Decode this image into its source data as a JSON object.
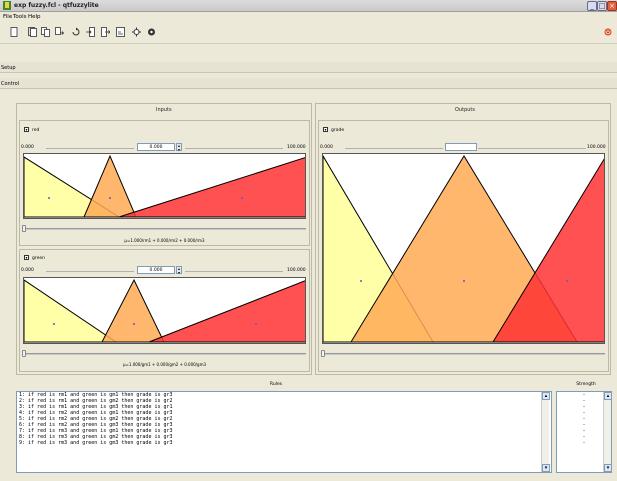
{
  "window": {
    "title": "exp fuzzy.fcl - qtfuzzylite"
  },
  "menu": [
    "File",
    "Tools",
    "Help"
  ],
  "toolbar": {
    "icons": [
      "new-icon",
      "open-icon",
      "copy-icon",
      "paste-icon",
      "undo-icon",
      "import-icon",
      "export-icon",
      "preview-icon",
      "settings-icon",
      "about-icon"
    ],
    "power_icon": "power-icon"
  },
  "sections": {
    "setup": "Setup",
    "control": "Control"
  },
  "inputs": {
    "title": "Inputs",
    "variables": [
      {
        "name": "red",
        "value": "0.000",
        "min": "0.000",
        "max": "100.000",
        "mu": "µ=1.000/rm1 + 0.000/rm2 + 0.000/rm3",
        "slider": 0.0
      },
      {
        "name": "green",
        "value": "0.000",
        "min": "0.000",
        "max": "100.000",
        "mu": "µ=1.000/gm1 + 0.000/gm2 + 0.000/gm3",
        "slider": 0.0
      }
    ]
  },
  "outputs": {
    "title": "Outputs",
    "variables": [
      {
        "name": "grade",
        "value": "",
        "min": "0.000",
        "max": "100.000",
        "slider": 0.0
      }
    ]
  },
  "rules": {
    "header": "Rules",
    "lines": [
      "1: if red is rm1 and green is gm1 then grade is gr3",
      "2: if red is rm1 and green is gm2 then grade is gr2",
      "3: if red is rm1 and green is gm3 then grade is gr1",
      "4: if red is rm2 and green is gm1 then grade is gr3",
      "5: if red is rm2 and green is gm2 then grade is gr2",
      "6: if red is rm2 and green is gm3 then grade is gr3",
      "7: if red is rm3 and green is gm1 then grade is gr3",
      "8: if red is rm3 and green is gm2 then grade is gr3",
      "9: if red is rm3 and green is gm3 then grade is gr3"
    ]
  },
  "strength": {
    "header": "Strength",
    "values": [
      "-",
      "-",
      "-",
      "-",
      "-",
      "-",
      "-",
      "-",
      "-"
    ]
  },
  "colors": {
    "term1": "#ffff99",
    "term2": "#ffaa55",
    "term3": "#ff3333",
    "accent_red": "#cc2200"
  }
}
